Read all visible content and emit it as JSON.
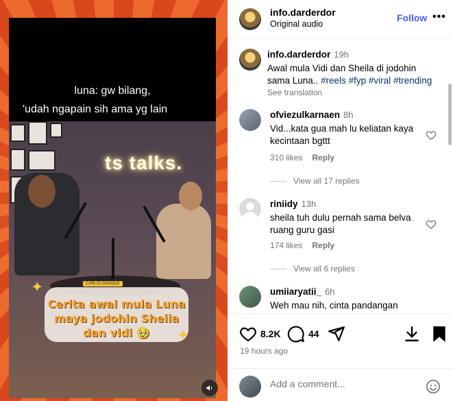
{
  "video": {
    "subtitle_line1": "luna: gw bilang,",
    "subtitle_line2": "'udah ngapain sih ama yg lain",
    "neon_sign": "ts talks.",
    "badge_tag": "CARI DI GOOGLE",
    "caption_line1": "Cerita awal mula Luna",
    "caption_line2": "maya jodohin Sheila",
    "caption_line3": "dan vidi 🥹",
    "volume_icon": "speaker-icon"
  },
  "header": {
    "username": "info.darderdor",
    "audio": "Original audio",
    "follow_label": "Follow",
    "more_label": "•••"
  },
  "caption": {
    "username": "info.darderdor",
    "time": "19h",
    "text": "Awal mula Vidi dan Sheila di jodohin sama Luna..",
    "hashtags": [
      "#reels",
      "#fyp",
      "#viral",
      "#trending"
    ],
    "see_translation": "See translation"
  },
  "comments": [
    {
      "username": "ofviezulkarnaen",
      "time": "8h",
      "text": "Vid...kata gua mah lu keliatan kaya kecintaan bgttt",
      "likes": "310 likes",
      "reply_label": "Reply",
      "view_replies": "View all 17 replies"
    },
    {
      "username": "riniidy",
      "time": "13h",
      "text": "sheila tuh dulu pernah sama belva ruang guru gasi",
      "likes": "174 likes",
      "reply_label": "Reply",
      "view_replies": "View all 6 replies"
    },
    {
      "username": "umiiaryatii_",
      "time": "6h",
      "text": "Weh mau nih, cinta pandangan"
    }
  ],
  "actions": {
    "likes_count": "8.2K",
    "comments_count": "44",
    "posted": "19 hours ago"
  },
  "add_comment": {
    "placeholder": "Add a comment..."
  },
  "colors": {
    "follow": "#4a5df9",
    "hashtag": "#00376b",
    "muted": "#737373"
  }
}
